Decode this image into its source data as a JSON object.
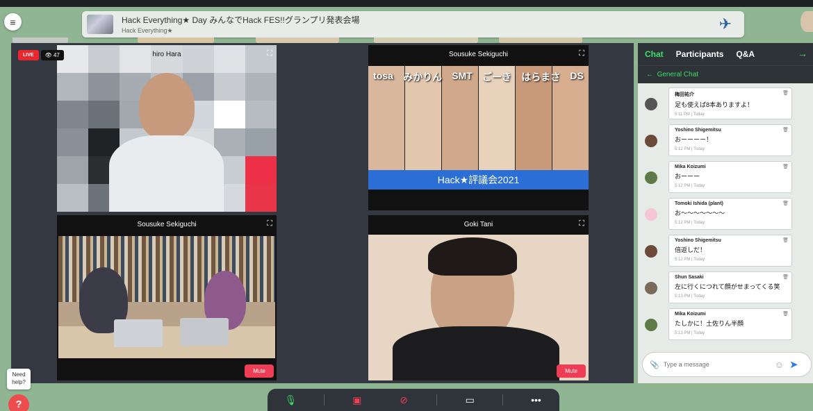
{
  "banner": {
    "title": "Hack Everything★ Day みんなでHack FES!!グランプリ発表会場",
    "subtitle": "Hack Everything★"
  },
  "live": {
    "badge": "LIVE",
    "viewers": "47"
  },
  "tiles": {
    "t1": {
      "name": "hiro Hara"
    },
    "t2": {
      "name": "Sousuke Sekiguchi",
      "poster_title": "Hack★評議会2021",
      "poster_names": [
        "tosa",
        "みかりん",
        "SMT",
        "ごーき",
        "はらまさ",
        "DS"
      ]
    },
    "t3": {
      "name": "Sousuke Sekiguchi",
      "mute": "Mute"
    },
    "t4": {
      "name": "Goki Tani",
      "mute": "Mute"
    }
  },
  "chat": {
    "tabs": [
      "Chat",
      "Participants",
      "Q&A"
    ],
    "channel": "General Chat",
    "placeholder": "Type a message",
    "messages": [
      {
        "name": "梅田祐介",
        "text": "足も使えば8本ありますよ！",
        "time": "5:11 PM | Today",
        "color": "#555"
      },
      {
        "name": "Yoshino Shigemitsu",
        "text": "おーーーー！",
        "time": "5:12 PM | Today",
        "color": "#6b4a3a"
      },
      {
        "name": "Mika Koizumi",
        "text": "おーーー",
        "time": "5:12 PM | Today",
        "color": "#5d7a48"
      },
      {
        "name": "Tomoki Ishida (plant)",
        "text": "お〜〜〜〜〜〜〜",
        "time": "5:12 PM | Today",
        "color": "#f4c6d6"
      },
      {
        "name": "Yoshino Shigemitsu",
        "text": "倍返しだ！",
        "time": "5:12 PM | Today",
        "color": "#6b4a3a"
      },
      {
        "name": "Shun Sasaki",
        "text": "左に行くにつれて顔がせまってくる笑",
        "time": "5:13 PM | Today",
        "color": "#7a6a5a"
      },
      {
        "name": "Mika Koizumi",
        "text": "たしかに！土佐りん半顔",
        "time": "5:13 PM | Today",
        "color": "#5d7a48"
      }
    ]
  },
  "help": {
    "label": "Need help?"
  }
}
